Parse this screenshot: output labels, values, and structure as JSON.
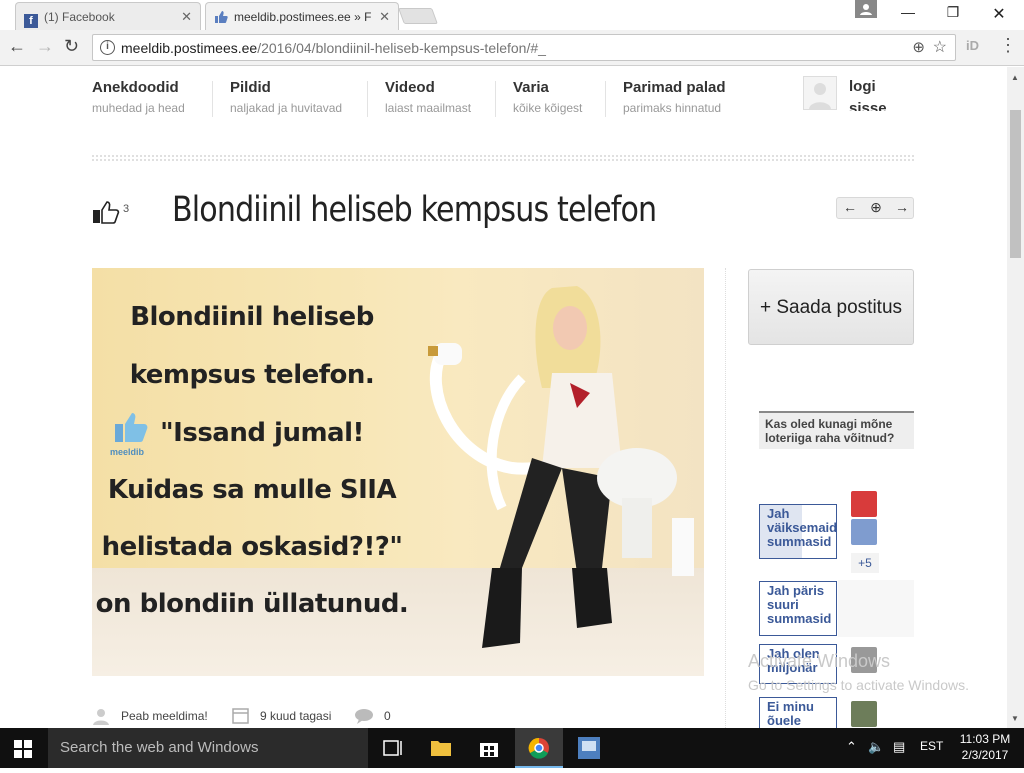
{
  "browser": {
    "tabs": [
      {
        "title": "(1) Facebook",
        "active": false,
        "favicon": "facebook-icon"
      },
      {
        "title": "meeldib.postimees.ee » F",
        "active": true,
        "favicon": "thumbs-up-icon"
      }
    ],
    "url_host": "meeldib.postimees.ee",
    "url_path": "/2016/04/blondiinil-heliseb-kempsus-telefon/#_"
  },
  "nav": {
    "items": [
      {
        "title": "Anekdoodid",
        "subtitle": "muhedad ja head"
      },
      {
        "title": "Pildid",
        "subtitle": "naljakad ja huvitavad"
      },
      {
        "title": "Videod",
        "subtitle": "laiast maailmast"
      },
      {
        "title": "Varia",
        "subtitle": "kõike kõigest"
      },
      {
        "title": "Parimad palad",
        "subtitle": "parimaks hinnatud"
      }
    ],
    "login_line1": "logi",
    "login_line2": "sisse"
  },
  "post": {
    "title": "Blondiinil heliseb kempsus telefon",
    "like_count": "3",
    "image_text": [
      "Blondiinil heliseb",
      "kempsus telefon.",
      "\"Issand jumal!",
      "Kuidas sa mulle SIIA",
      "helistada oskasid?!?\"",
      "on blondiin üllatunud."
    ],
    "watermark": "meeldib",
    "author": "Peab meeldima!",
    "time": "9 kuud tagasi",
    "comments": "0"
  },
  "sidebar": {
    "send_button": "+ Saada postitus",
    "poll_question": "Kas oled kunagi mõne loteriiga raha võitnud?",
    "poll_options": [
      {
        "label": "Jah väiksemaid summasid",
        "fill": 0.55
      },
      {
        "label": "Jah päris suuri summasid",
        "fill": 0
      },
      {
        "label": "Jah olen miljonär",
        "fill": 0
      },
      {
        "label": "Ei minu õuele",
        "fill": 0
      }
    ],
    "more_voters": "+5"
  },
  "watermark": {
    "line1": "Activate Windows",
    "line2": "Go to Settings to activate Windows."
  },
  "taskbar": {
    "search_placeholder": "Search the web and Windows",
    "language": "EST",
    "time": "11:03 PM",
    "date": "2/3/2017"
  },
  "colors": {
    "link_blue": "#3b5998",
    "taskbar": "#101010"
  }
}
